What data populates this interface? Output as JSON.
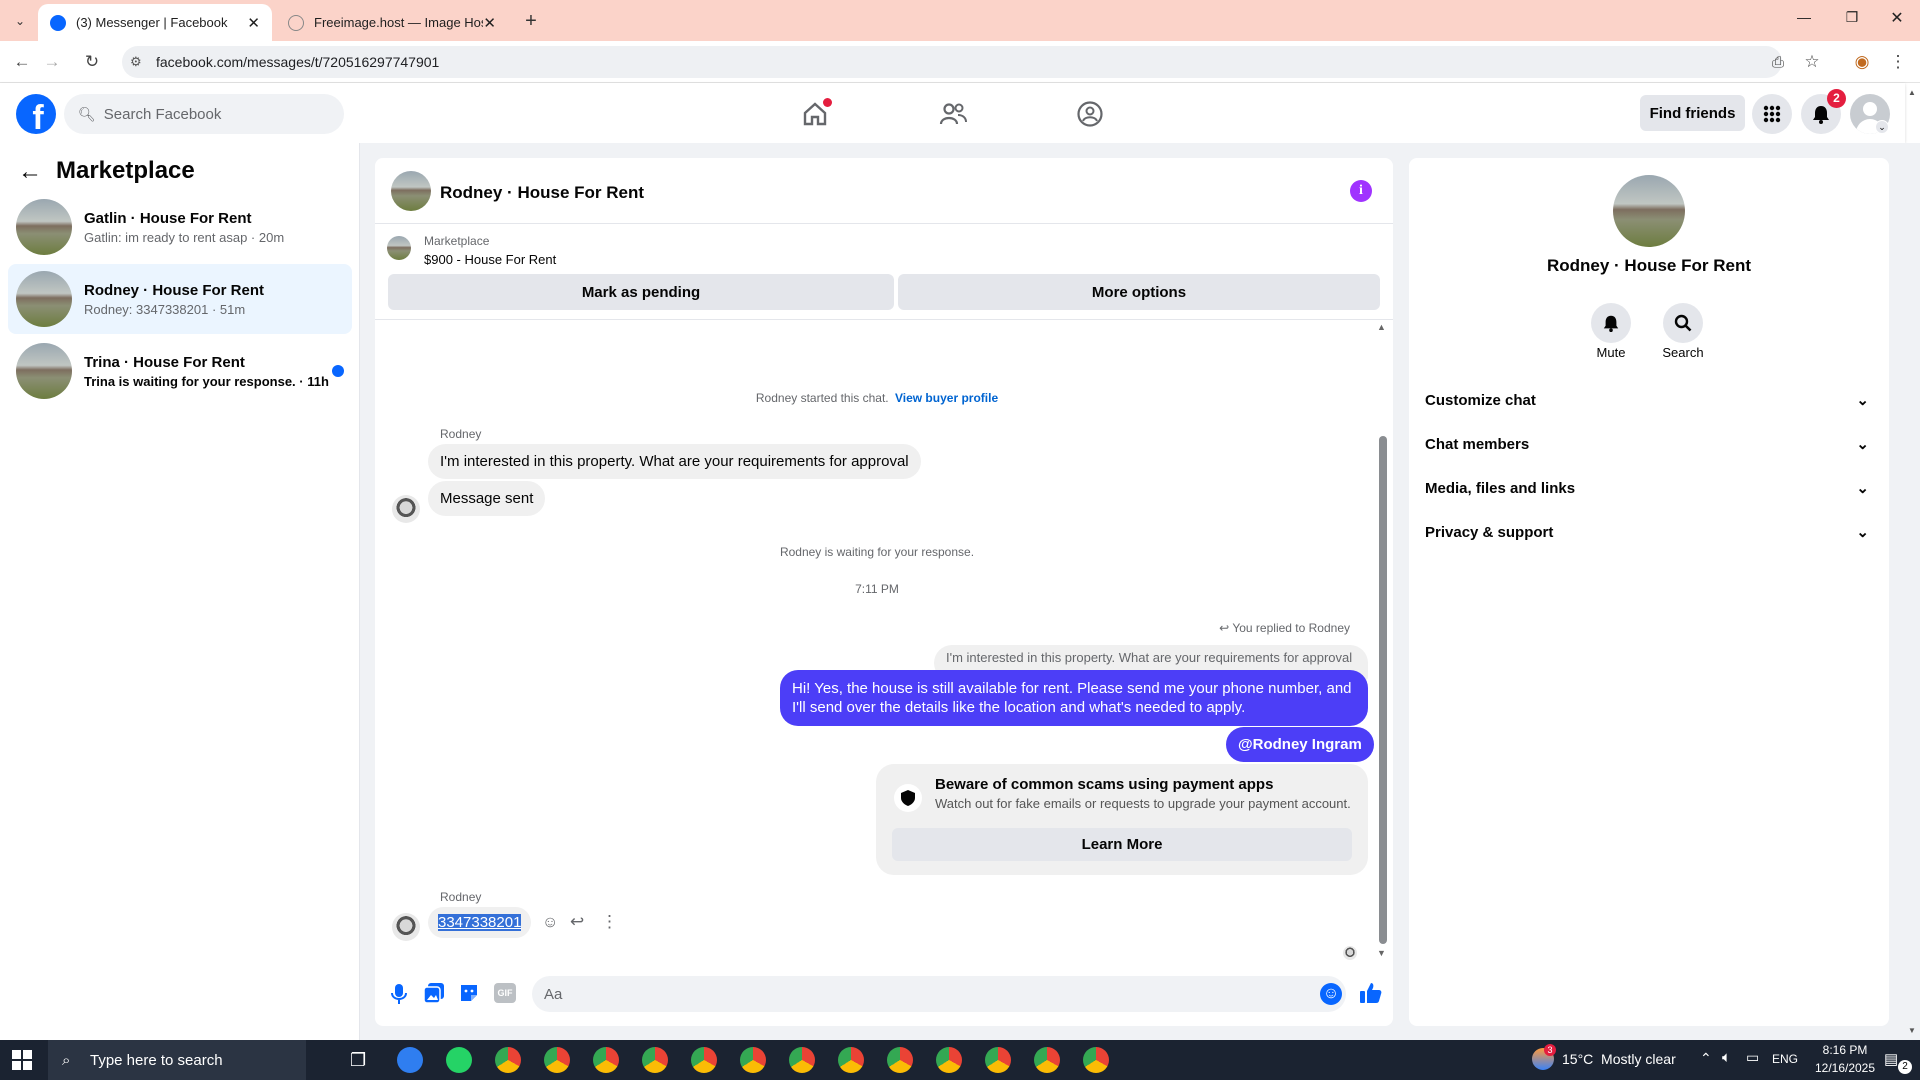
{
  "browser": {
    "tabs": [
      {
        "label": "(3) Messenger | Facebook",
        "active": true
      },
      {
        "label": "Freeimage.host — Image Hosti",
        "active": false
      }
    ],
    "url": "facebook.com/messages/t/720516297747901"
  },
  "fb_header": {
    "logo": "f",
    "search_placeholder": "Search Facebook",
    "find_friends_label": "Find friends",
    "notification_count": "2"
  },
  "sidebar": {
    "title": "Marketplace",
    "conversations": [
      {
        "name": "Gatlin · House For Rent",
        "preview": "Gatlin: im ready to rent asap · 20m",
        "selected": false,
        "unread": false
      },
      {
        "name": "Rodney · House For Rent",
        "preview": "Rodney: 3347338201 · 51m",
        "selected": true,
        "unread": false
      },
      {
        "name": "Trina · House For Rent",
        "preview": "Trina is waiting for your response. · 11h",
        "selected": false,
        "unread": true
      }
    ]
  },
  "chat": {
    "title": "Rodney · House For Rent",
    "listing_category": "Marketplace",
    "listing_detail": "$900 - House For Rent",
    "mark_pending_label": "Mark as pending",
    "more_options_label": "More options",
    "started_text": "Rodney started this chat.",
    "view_profile_link": "View buyer profile",
    "sender_name": "Rodney",
    "msg_interested": "I'm interested in this property. What are your requirements for approval",
    "msg_sent": "Message sent",
    "waiting_text": "Rodney is waiting for your response.",
    "timestamp": "7:11 PM",
    "replied_to": "You replied to Rodney",
    "quoted_text": "I'm interested in this property. What are your requirements for approval",
    "my_reply": "Hi! Yes, the house is still available for rent. Please send me your phone number, and I'll send over the details like the location and what's needed to apply.",
    "mention": "@Rodney Ingram",
    "scam_title": "Beware of common scams using payment apps",
    "scam_body": "Watch out for fake emails or requests to upgrade your payment account.",
    "learn_more_label": "Learn More",
    "sender_name_2": "Rodney",
    "phone_message": "3347338201",
    "composer_placeholder": "Aa"
  },
  "info_panel": {
    "name": "Rodney · House For Rent",
    "mute_label": "Mute",
    "search_label": "Search",
    "sections": [
      "Customize chat",
      "Chat members",
      "Media, files and links",
      "Privacy & support"
    ]
  },
  "taskbar": {
    "search_placeholder": "Type here to search",
    "weather": "15°C  Mostly clear",
    "weather_badge": "3",
    "language": "ENG",
    "time": "8:16 PM",
    "date": "12/16/2025",
    "notifications": "2"
  },
  "colors": {
    "fb_blue": "#0866ff",
    "outgoing_bubble": "#4c3ef7",
    "accent_purple": "#a033ff",
    "tabstrip": "#fbd3c9"
  }
}
